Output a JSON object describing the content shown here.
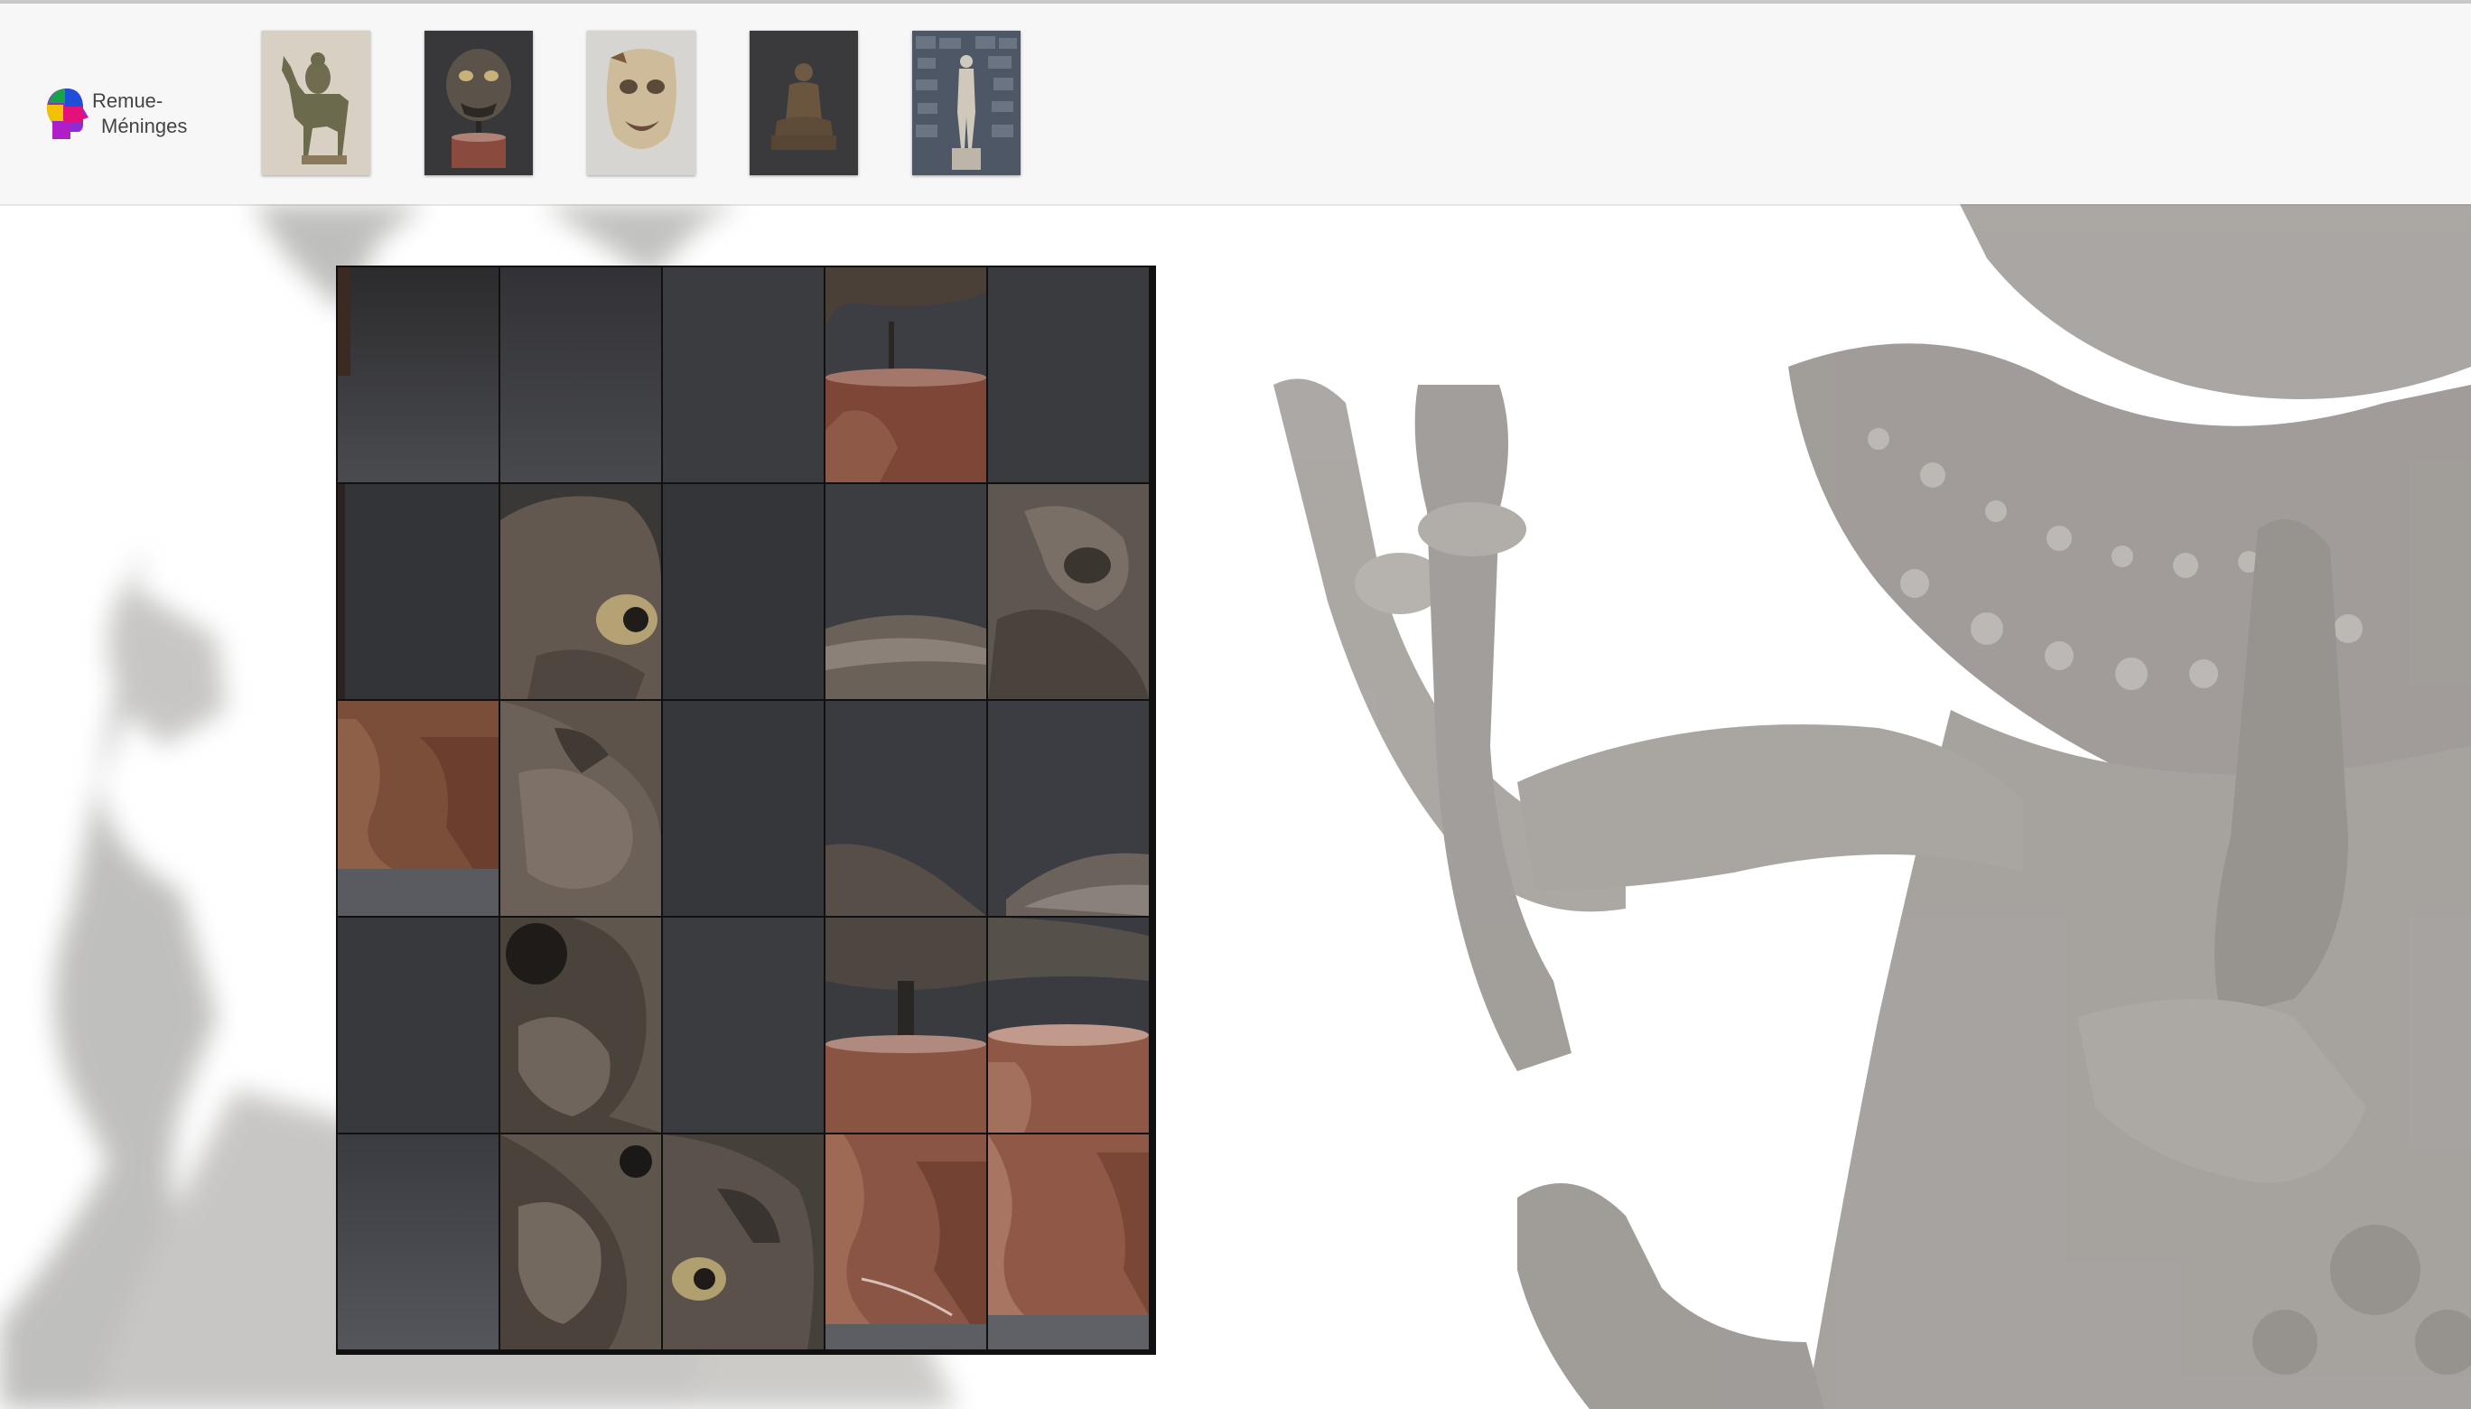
{
  "logo": {
    "line1": "Remue-",
    "line2": "Méninges"
  },
  "thumbnails": [
    {
      "name": "camel-rider-bronze",
      "bg": "#d8cfc2",
      "fg": "#6c6a4e"
    },
    {
      "name": "demon-mask-on-stand",
      "bg": "#3a3a3c",
      "fg": "#5a5046"
    },
    {
      "name": "painted-wooden-mask",
      "bg": "#d5d4d0",
      "fg": "#c9b99c"
    },
    {
      "name": "seated-buddha-bronze",
      "bg": "#3b3b3d",
      "fg": "#6a5a46"
    },
    {
      "name": "standing-statue-stone-wall",
      "bg": "#4a5462",
      "fg": "#c8c2b6"
    }
  ],
  "puzzle": {
    "rows": 5,
    "cols": 5,
    "tiles": [
      [
        "dark-left",
        "dark",
        "dark",
        "stand-top",
        "dark"
      ],
      [
        "dark",
        "mask-eye-left",
        "dark",
        "mask-chin",
        "mask-eye-right"
      ],
      [
        "marble",
        "mask-cheek",
        "dark",
        "mask-chin-edge",
        "mask-edge"
      ],
      [
        "dark",
        "mask-nose",
        "dark",
        "stand-post",
        "marble-top"
      ],
      [
        "dark-light",
        "mask-mouth",
        "mask-eye-low",
        "marble",
        "marble-edge"
      ]
    ]
  }
}
